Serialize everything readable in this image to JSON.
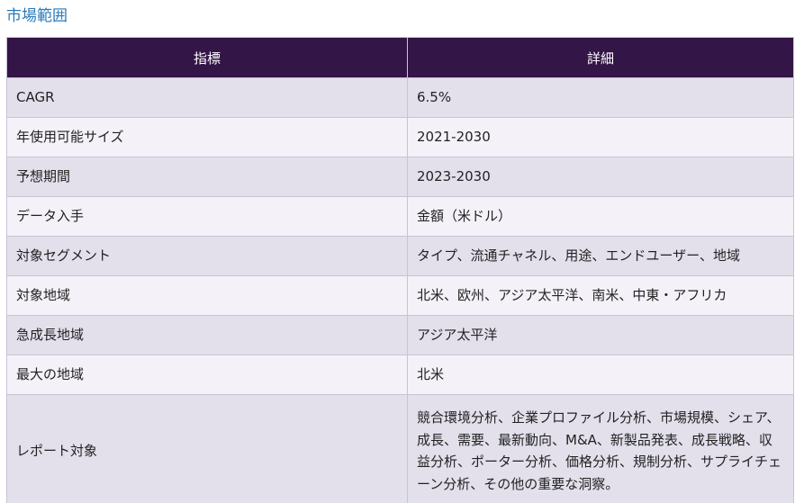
{
  "section_title": "市場範囲",
  "table": {
    "headers": [
      "指標",
      "詳細"
    ],
    "rows": [
      {
        "metric": "CAGR",
        "detail": "6.5%"
      },
      {
        "metric": "年使用可能サイズ",
        "detail": "2021-2030"
      },
      {
        "metric": "予想期間",
        "detail": "2023-2030"
      },
      {
        "metric": "データ入手",
        "detail": "金額（米ドル）"
      },
      {
        "metric": "対象セグメント",
        "detail": "タイプ、流通チャネル、用途、エンドユーザー、地域"
      },
      {
        "metric": "対象地域",
        "detail": "北米、欧州、アジア太平洋、南米、中東・アフリカ"
      },
      {
        "metric": "急成長地域",
        "detail": "アジア太平洋"
      },
      {
        "metric": "最大の地域",
        "detail": "北米"
      },
      {
        "metric": "レポート対象",
        "detail": "競合環境分析、企業プロファイル分析、市場規模、シェア、成長、需要、最新動向、M&A、新製品発表、成長戦略、収益分析、ポーター分析、価格分析、規制分析、サプライチェーン分析、その他の重要な洞察。"
      }
    ]
  },
  "colors": {
    "header_bg": "#341547",
    "header_text": "#ffffff",
    "row_odd": "#e3e0ec",
    "row_even": "#f4f2f8",
    "title_link": "#2a7ab8"
  }
}
